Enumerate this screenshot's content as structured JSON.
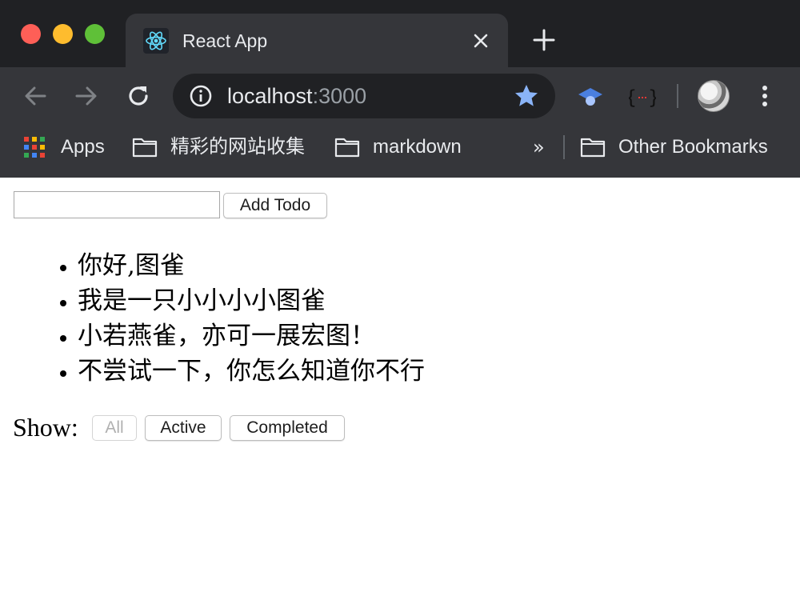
{
  "browser": {
    "tab": {
      "title": "React App",
      "favicon": "react-logo-icon"
    },
    "address": {
      "host": "localhost",
      "port": ":3000"
    },
    "bookmarks": {
      "apps_label": "Apps",
      "items": [
        {
          "label": "精彩的网站收集",
          "icon": "folder-icon"
        },
        {
          "label": "markdown",
          "icon": "folder-icon"
        }
      ],
      "overflow_label": "»",
      "other_label": "Other Bookmarks"
    },
    "colors": {
      "frame": "#202124",
      "toolbar": "#35363a",
      "text": "#e8eaed",
      "star": "#8ab4f8"
    }
  },
  "app": {
    "input": {
      "value": "",
      "placeholder": ""
    },
    "add_button_label": "Add Todo",
    "todos": [
      "你好,图雀",
      "我是一只小小小小图雀",
      "小若燕雀，亦可一展宏图！",
      "不尝试一下，你怎么知道你不行"
    ],
    "filter": {
      "label": "Show:",
      "options": [
        "All",
        "Active",
        "Completed"
      ],
      "selected": "All"
    }
  }
}
